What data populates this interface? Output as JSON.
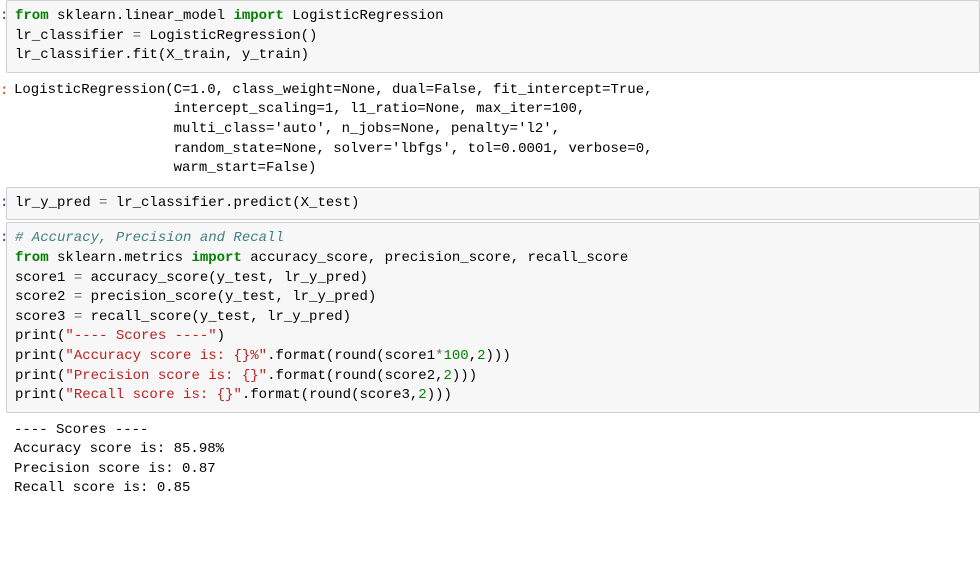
{
  "cells": [
    {
      "type": "code",
      "prompt": ":",
      "content": {
        "l1_kw1": "from",
        "l1_mod": " sklearn.linear_model ",
        "l1_kw2": "import",
        "l1_imp": " LogisticRegression",
        "l2": "lr_classifier ",
        "l2_op": "=",
        "l2_b": " LogisticRegression()",
        "l3": "lr_classifier.fit(X_train, y_train)"
      }
    },
    {
      "type": "output",
      "prompt": ":",
      "content": {
        "text": "LogisticRegression(C=1.0, class_weight=None, dual=False, fit_intercept=True,\n                   intercept_scaling=1, l1_ratio=None, max_iter=100,\n                   multi_class='auto', n_jobs=None, penalty='l2',\n                   random_state=None, solver='lbfgs', tol=0.0001, verbose=0,\n                   warm_start=False)"
      }
    },
    {
      "type": "code",
      "prompt": ":",
      "content": {
        "l1a": "lr_y_pred ",
        "l1op": "=",
        "l1b": " lr_classifier.predict(X_test)"
      }
    },
    {
      "type": "code",
      "prompt": ":",
      "content": {
        "c1": "# Accuracy, Precision and Recall",
        "l2_kw1": "from",
        "l2_mod": " sklearn.metrics ",
        "l2_kw2": "import",
        "l2_imp": " accuracy_score, precision_score, recall_score",
        "l3a": "score1 ",
        "l3op": "=",
        "l3b": " accuracy_score(y_test, lr_y_pred)",
        "l4a": "score2 ",
        "l4op": "=",
        "l4b": " precision_score(y_test, lr_y_pred)",
        "l5a": "score3 ",
        "l5op": "=",
        "l5b": " recall_score(y_test, lr_y_pred)",
        "l6a": "print(",
        "l6s": "\"---- Scores ----\"",
        "l6b": ")",
        "l7a": "print(",
        "l7s": "\"Accuracy score is: {}%\"",
        "l7b": ".format(round(score1",
        "l7op": "*",
        "l7n1": "100",
        "l7c": ",",
        "l7n2": "2",
        "l7d": ")))",
        "l8a": "print(",
        "l8s": "\"Precision score is: {}\"",
        "l8b": ".format(round(score2,",
        "l8n": "2",
        "l8c": ")))",
        "l9a": "print(",
        "l9s": "\"Recall score is: {}\"",
        "l9b": ".format(round(score3,",
        "l9n": "2",
        "l9c": ")))"
      }
    },
    {
      "type": "plain-output",
      "content": {
        "text": "---- Scores ----\nAccuracy score is: 85.98%\nPrecision score is: 0.87\nRecall score is: 0.85"
      }
    }
  ]
}
